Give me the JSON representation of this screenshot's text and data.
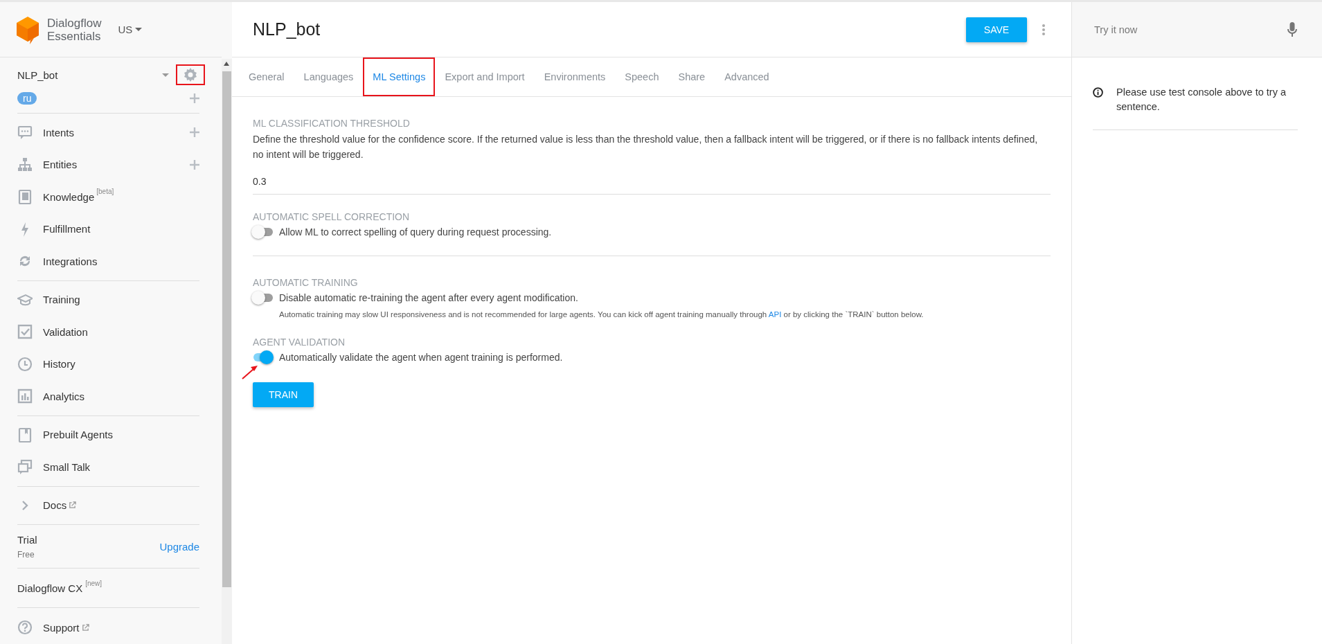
{
  "brand": {
    "line1": "Dialogflow",
    "line2": "Essentials",
    "region": "US"
  },
  "agent": {
    "name": "NLP_bot",
    "language": "ru",
    "settings_highlighted": true
  },
  "nav_groups": [
    {
      "items": [
        {
          "label": "Intents",
          "add": true
        },
        {
          "label": "Entities",
          "add": true
        },
        {
          "label": "Knowledge",
          "sup": "[beta]",
          "add": false
        },
        {
          "label": "Fulfillment",
          "add": false
        },
        {
          "label": "Integrations",
          "add": false
        }
      ]
    },
    {
      "items": [
        {
          "label": "Training",
          "add": false
        },
        {
          "label": "Validation",
          "add": false
        },
        {
          "label": "History",
          "add": false
        },
        {
          "label": "Analytics",
          "add": false
        }
      ]
    },
    {
      "items": [
        {
          "label": "Prebuilt Agents",
          "add": false
        },
        {
          "label": "Small Talk",
          "add": false
        }
      ]
    },
    {
      "items": [
        {
          "label": "Docs",
          "add": false,
          "external": true
        }
      ]
    }
  ],
  "plan": {
    "title": "Trial",
    "subtitle": "Free",
    "action": "Upgrade"
  },
  "cx": {
    "label": "Dialogflow CX",
    "sup": "[new]"
  },
  "support": {
    "label": "Support",
    "external": true
  },
  "header": {
    "title": "NLP_bot",
    "save": "SAVE"
  },
  "tabs": [
    {
      "label": "General",
      "selected": false,
      "highlighted": false
    },
    {
      "label": "Languages",
      "selected": false,
      "highlighted": false
    },
    {
      "label": "ML Settings",
      "selected": true,
      "highlighted": true
    },
    {
      "label": "Export and Import",
      "selected": false,
      "highlighted": false
    },
    {
      "label": "Environments",
      "selected": false,
      "highlighted": false
    },
    {
      "label": "Speech",
      "selected": false,
      "highlighted": false
    },
    {
      "label": "Share",
      "selected": false,
      "highlighted": false
    },
    {
      "label": "Advanced",
      "selected": false,
      "highlighted": false
    }
  ],
  "sections": [
    {
      "kind": "field",
      "heading": "ML CLASSIFICATION THRESHOLD",
      "description": "Define the threshold value for the confidence score. If the returned value is less than the threshold value, then a fallback intent will be triggered, or if there is no fallback intents defined, no intent will be triggered.",
      "value": "0.3"
    },
    {
      "kind": "toggle",
      "heading": "AUTOMATIC SPELL CORRECTION",
      "label": "Allow ML to correct spelling of query during request processing.",
      "on": false
    },
    {
      "kind": "toggle",
      "heading": "AUTOMATIC TRAINING",
      "label": "Disable automatic re-training the agent after every agent modification.",
      "on": false,
      "note": {
        "before": "Automatic training may slow UI responsiveness and is not recommended for large agents. You can kick off agent training manually through ",
        "link": "API",
        "after": " or by clicking the `TRAIN` button below."
      }
    },
    {
      "kind": "toggle",
      "heading": "AGENT VALIDATION",
      "label": "Automatically validate the agent when agent training is performed.",
      "on": true,
      "pointer_arrow": true
    }
  ],
  "train_button": "TRAIN",
  "console": {
    "placeholder": "Try it now",
    "message": "Please use test console above to try a sentence."
  }
}
